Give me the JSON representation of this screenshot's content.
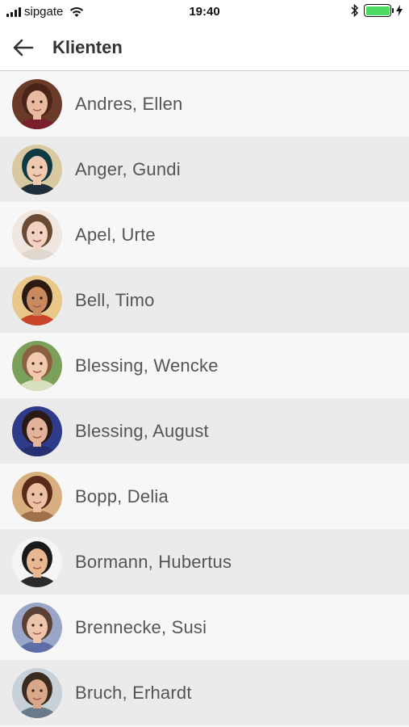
{
  "status_bar": {
    "carrier": "sipgate",
    "time": "19:40",
    "battery_color": "#4cd964"
  },
  "nav": {
    "title": "Klienten",
    "back_icon": "arrow-left-icon"
  },
  "clients": [
    {
      "name": "Andres, Ellen",
      "avatar": {
        "bg": "#6b3b2a",
        "skin": "#e9b9a0",
        "hair": "#4a2418",
        "shirt": "#7a1f2b"
      }
    },
    {
      "name": "Anger, Gundi",
      "avatar": {
        "bg": "#d9c9a0",
        "skin": "#efc9b0",
        "hair": "#0e3a44",
        "shirt": "#1e2e3a"
      }
    },
    {
      "name": "Apel, Urte",
      "avatar": {
        "bg": "#efe7e0",
        "skin": "#f2d3c2",
        "hair": "#6a4a33",
        "shirt": "#e0d7cf"
      }
    },
    {
      "name": "Bell, Timo",
      "avatar": {
        "bg": "#e9c88a",
        "skin": "#c98a60",
        "hair": "#2a1a12",
        "shirt": "#c8442a"
      }
    },
    {
      "name": "Blessing, Wencke",
      "avatar": {
        "bg": "#7aa05a",
        "skin": "#f0c9ae",
        "hair": "#8a6040",
        "shirt": "#d9e0c0"
      }
    },
    {
      "name": "Blessing, August",
      "avatar": {
        "bg": "#2e3a8a",
        "skin": "#e2b39a",
        "hair": "#2a1a14",
        "shirt": "#263070"
      }
    },
    {
      "name": "Bopp, Delia",
      "avatar": {
        "bg": "#d8b080",
        "skin": "#eac1a3",
        "hair": "#5a2a1a",
        "shirt": "#a0704a"
      }
    },
    {
      "name": "Bormann, Hubertus",
      "avatar": {
        "bg": "#f5f5f5",
        "skin": "#e8b890",
        "hair": "#1a1a1a",
        "shirt": "#2a2a2a"
      }
    },
    {
      "name": "Brennecke, Susi",
      "avatar": {
        "bg": "#9aa6c8",
        "skin": "#edc5ad",
        "hair": "#5a4034",
        "shirt": "#5d6ea8"
      }
    },
    {
      "name": "Bruch, Erhardt",
      "avatar": {
        "bg": "#c8d0d8",
        "skin": "#d9a888",
        "hair": "#3a2a20",
        "shirt": "#6a7a8a"
      }
    }
  ]
}
